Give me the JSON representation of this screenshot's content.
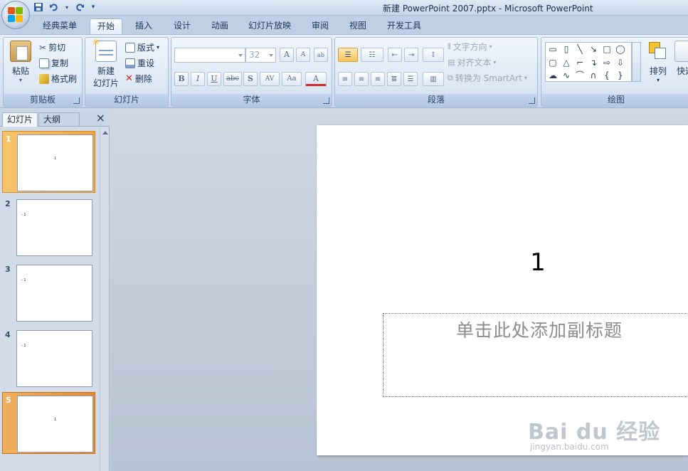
{
  "window": {
    "title": "新建 PowerPoint 2007.pptx - Microsoft PowerPoint"
  },
  "quick_access": {
    "icons": [
      "save-icon",
      "undo-icon",
      "redo-icon",
      "customize-icon"
    ]
  },
  "tabs": [
    {
      "label": "经典菜单",
      "active": false
    },
    {
      "label": "开始",
      "active": true
    },
    {
      "label": "插入",
      "active": false
    },
    {
      "label": "设计",
      "active": false
    },
    {
      "label": "动画",
      "active": false
    },
    {
      "label": "幻灯片放映",
      "active": false
    },
    {
      "label": "审阅",
      "active": false
    },
    {
      "label": "视图",
      "active": false
    },
    {
      "label": "开发工具",
      "active": false
    }
  ],
  "ribbon": {
    "clipboard": {
      "label": "剪贴板",
      "paste": "粘贴",
      "cut": "剪切",
      "copy": "复制",
      "format_painter": "格式刷"
    },
    "slides": {
      "label": "幻灯片",
      "new_slide_line1": "新建",
      "new_slide_line2": "幻灯片",
      "layout": "版式",
      "reset": "重设",
      "delete": "删除"
    },
    "font": {
      "label": "字体",
      "font_name": "",
      "font_size": "32",
      "grow": "A",
      "shrink": "A",
      "bold": "B",
      "italic": "I",
      "underline": "U",
      "strike": "abc",
      "shadow": "S",
      "spacing": "AV",
      "case": "Aa",
      "color": "A"
    },
    "paragraph": {
      "label": "段落",
      "text_direction": "文字方向",
      "align_text": "对齐文本",
      "smartart": "转换为 SmartArt"
    },
    "drawing": {
      "label": "绘图",
      "arrange": "排列",
      "quick_styles": "快速"
    }
  },
  "left_panel": {
    "tab_slides": "幻灯片",
    "tab_outline": "大纲",
    "close": "×",
    "thumbnails": [
      {
        "number": "1",
        "text": "1",
        "selected": true
      },
      {
        "number": "2",
        "text": "- 1",
        "selected": false
      },
      {
        "number": "3",
        "text": "- 1",
        "selected": false
      },
      {
        "number": "4",
        "text": "- 1",
        "selected": false
      },
      {
        "number": "5",
        "text": "1",
        "selected": true
      }
    ]
  },
  "slide": {
    "title": "1",
    "subtitle_placeholder": "单击此处添加副标题"
  },
  "watermark": {
    "brand": "Bai du 经验",
    "url": "jingyan.baidu.com"
  }
}
